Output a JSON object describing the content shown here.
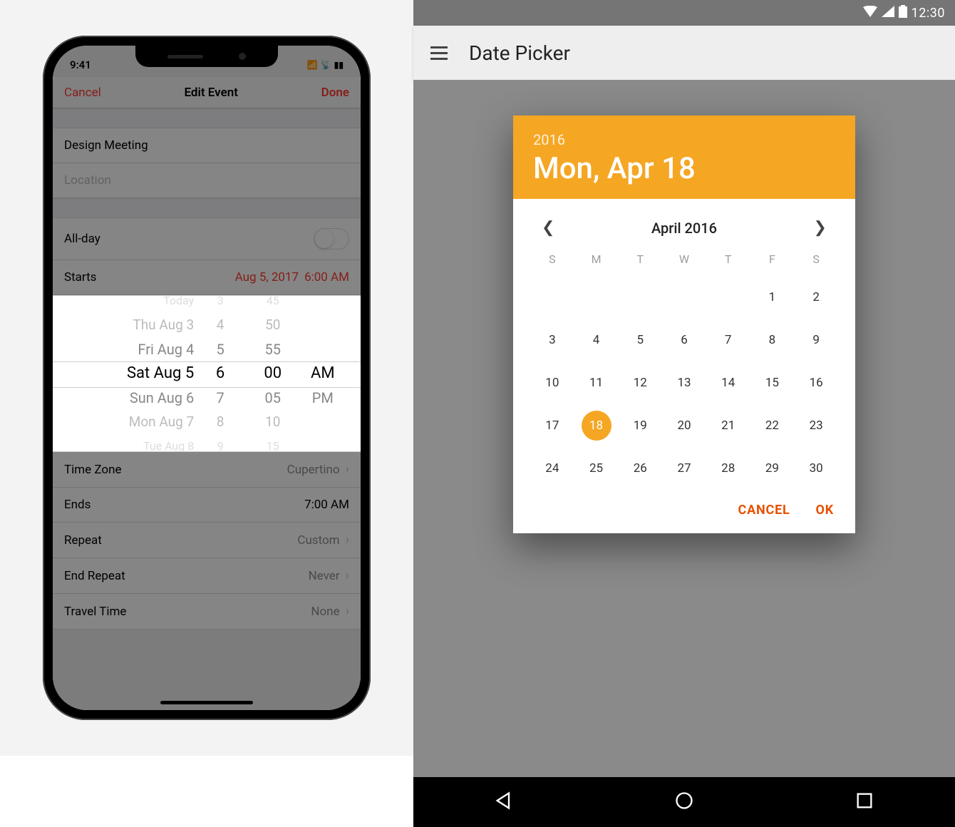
{
  "ios": {
    "status": {
      "time": "9:41",
      "signal_icon": "signal-icon",
      "wifi_icon": "wifi-icon",
      "battery_icon": "battery-icon"
    },
    "nav": {
      "cancel": "Cancel",
      "title": "Edit Event",
      "done": "Done"
    },
    "form": {
      "event_title": "Design Meeting",
      "location_placeholder": "Location",
      "allday_label": "All-day",
      "allday_on": false,
      "starts_label": "Starts",
      "starts_date": "Aug 5, 2017",
      "starts_time": "6:00 AM",
      "timezone_label": "Time Zone",
      "timezone_value": "Cupertino",
      "ends_label": "Ends",
      "ends_value": "7:00 AM",
      "repeat_label": "Repeat",
      "repeat_value": "Custom",
      "endrepeat_label": "End Repeat",
      "endrepeat_value": "Never",
      "travel_label": "Travel Time",
      "travel_value": "None"
    },
    "wheel": {
      "date": [
        "Today",
        "Thu Aug 3",
        "Fri Aug 4",
        "Sat Aug 5",
        "Sun Aug 6",
        "Mon Aug 7",
        "Tue Aug 8"
      ],
      "hour": [
        "3",
        "4",
        "5",
        "6",
        "7",
        "8",
        "9"
      ],
      "minute": [
        "45",
        "50",
        "55",
        "00",
        "05",
        "10",
        "15"
      ],
      "ampm": [
        "",
        "",
        "",
        "AM",
        "PM",
        "",
        ""
      ],
      "selected_index": 3
    }
  },
  "android": {
    "status": {
      "time": "12:30"
    },
    "appbar": {
      "title": "Date Picker"
    },
    "dialog": {
      "accent": "#f5a623",
      "action_color": "#e65100",
      "year": "2016",
      "date_display": "Mon, Apr 18",
      "month_label": "April 2016",
      "dow": [
        "S",
        "M",
        "T",
        "W",
        "T",
        "F",
        "S"
      ],
      "leading_blanks": 5,
      "days_in_month": 30,
      "selected_day": 18,
      "cancel": "CANCEL",
      "ok": "OK"
    }
  }
}
